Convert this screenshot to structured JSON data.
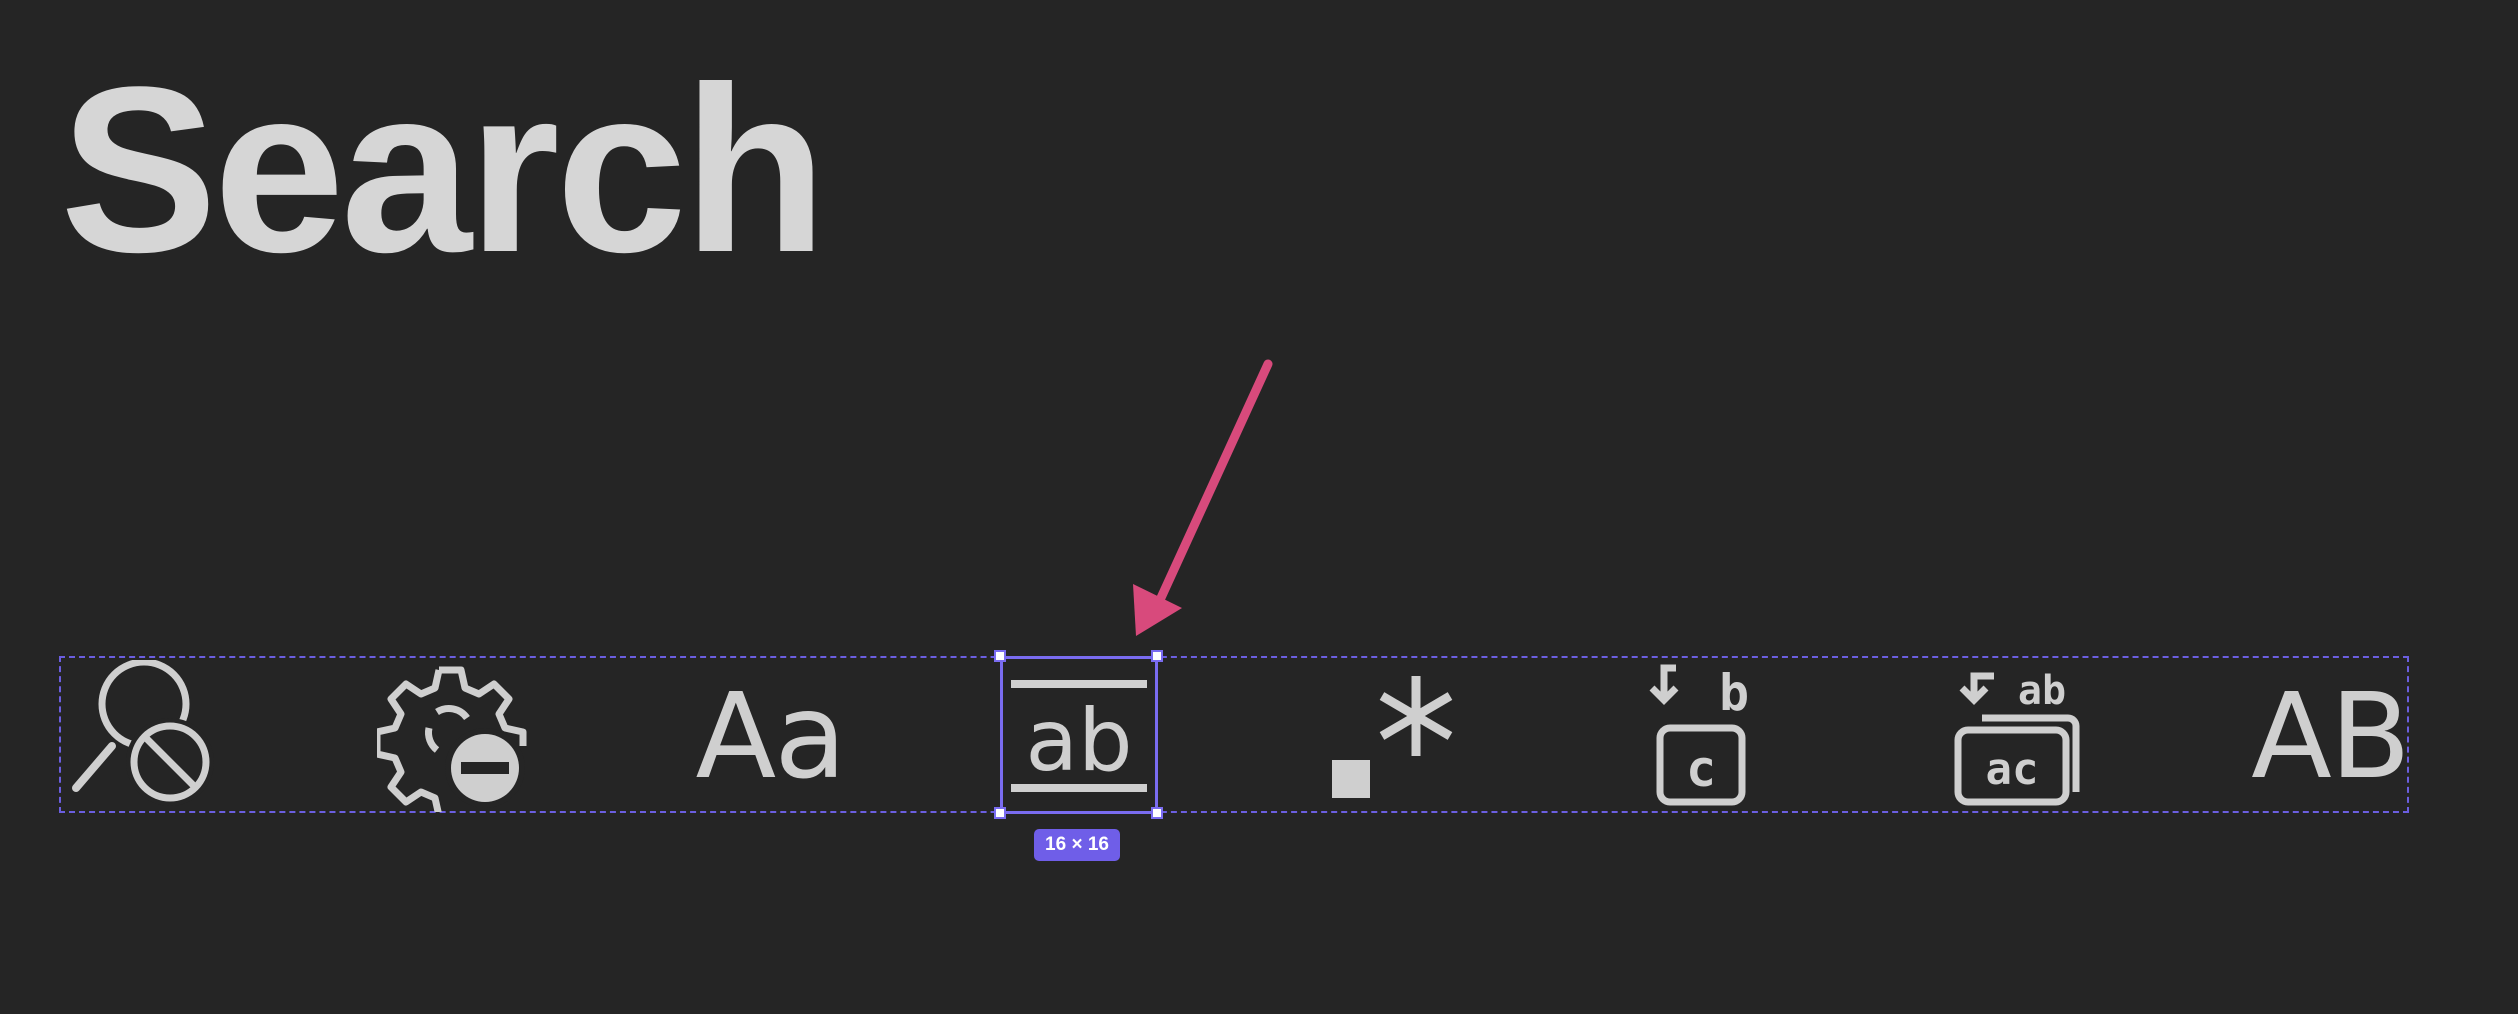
{
  "page": {
    "title": "Search"
  },
  "selection": {
    "size_label": "16 × 16"
  },
  "icons": [
    {
      "name": "search-stop-icon"
    },
    {
      "name": "settings-gear-remove-icon"
    },
    {
      "name": "match-case-icon",
      "glyph": "Aa"
    },
    {
      "name": "match-whole-word-icon",
      "glyph": "ab"
    },
    {
      "name": "regex-icon"
    },
    {
      "name": "replace-icon",
      "glyph_top": "b",
      "glyph_box": "c"
    },
    {
      "name": "replace-all-icon",
      "glyph_top": "ab",
      "glyph_box": "ac"
    },
    {
      "name": "preserve-case-icon",
      "glyph": "AB"
    }
  ],
  "colors": {
    "background": "#252525",
    "icon": "#cfcfcf",
    "selection": "#7a6cf0",
    "arrow": "#d84a7c"
  }
}
